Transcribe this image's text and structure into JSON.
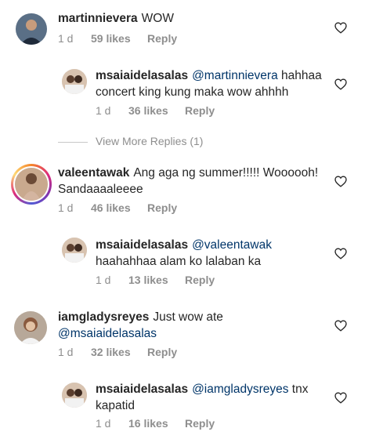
{
  "comments": [
    {
      "username": "martinnievera",
      "text": "WOW",
      "time": "1 d",
      "likes": "59 likes",
      "reply": "Reply",
      "reply_level": false
    },
    {
      "username": "msaiaidelasalas",
      "mention": "@martinnievera",
      "text": "hahhaa concert king kung maka wow ahhhh",
      "time": "1 d",
      "likes": "36 likes",
      "reply": "Reply",
      "reply_level": true
    },
    {
      "username": "valeentawak",
      "text": "Ang aga ng summer!!!!! Woooooh! Sandaaaaleeee",
      "time": "1 d",
      "likes": "46 likes",
      "reply": "Reply",
      "reply_level": false
    },
    {
      "username": "msaiaidelasalas",
      "mention": "@valeentawak",
      "text": "haahahhaa alam ko lalaban ka",
      "time": "1 d",
      "likes": "13 likes",
      "reply": "Reply",
      "reply_level": true
    },
    {
      "username": "iamgladysreyes",
      "text": "Just wow ate",
      "mention_after": "@msaiaidelasalas",
      "time": "1 d",
      "likes": "32 likes",
      "reply": "Reply",
      "reply_level": false
    },
    {
      "username": "msaiaidelasalas",
      "mention": "@iamgladysreyes",
      "text": "tnx kapatid",
      "time": "1 d",
      "likes": "16 likes",
      "reply": "Reply",
      "reply_level": true
    }
  ],
  "view_more": "View More Replies (1)",
  "icons": {
    "like": "heart-outline-icon"
  },
  "colors": {
    "text": "#262626",
    "meta": "#8e8e8e",
    "mention": "#003569"
  }
}
